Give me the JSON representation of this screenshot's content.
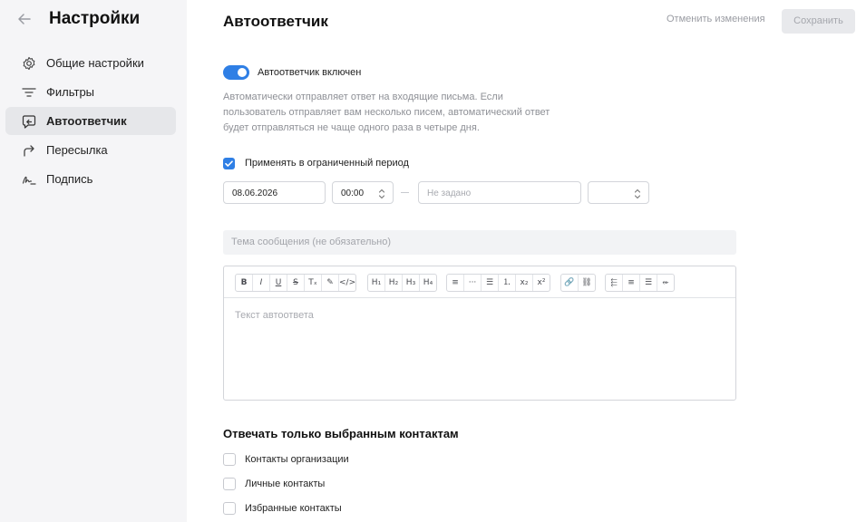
{
  "sidebar": {
    "title": "Настройки",
    "items": [
      {
        "label": "Общие настройки",
        "icon": "gear-icon"
      },
      {
        "label": "Фильтры",
        "icon": "filter-icon"
      },
      {
        "label": "Автоответчик",
        "icon": "autoreply-icon",
        "active": true
      },
      {
        "label": "Пересылка",
        "icon": "forward-icon"
      },
      {
        "label": "Подпись",
        "icon": "signature-icon"
      }
    ]
  },
  "header": {
    "title": "Автоответчик",
    "cancel_label": "Отменить изменения",
    "save_label": "Сохранить"
  },
  "autoreply": {
    "toggle_label": "Автоответчик включен",
    "toggle_on": true,
    "description": "Автоматически отправляет ответ на входящие письма. Если пользователь отправляет вам несколько писем, автоматический ответ будет отправляться не чаще одного раза в четыре дня."
  },
  "period": {
    "checkbox_label": "Применять в ограниченный период",
    "checked": true,
    "start_date": "08.06.2026",
    "start_time": "00:00",
    "end_date_placeholder": "Не задано",
    "end_time": ""
  },
  "subject_placeholder": "Тема сообщения (не обязательно)",
  "editor": {
    "placeholder": "Текст автоответа",
    "toolbar_groups": [
      [
        "B",
        "I",
        "U",
        "S",
        "Tₓ",
        "✎",
        "</>"
      ],
      [
        "H₁",
        "H₂",
        "H₃",
        "H₄"
      ],
      [
        "≡",
        "···",
        "☰",
        "⒈",
        "x₂",
        "x²"
      ],
      [
        "🔗",
        "⛓"
      ],
      [
        "⬱",
        "≡",
        "☰",
        "⬰"
      ]
    ]
  },
  "contacts": {
    "title": "Отвечать только выбранным контактам",
    "options": [
      {
        "label": "Контакты организации",
        "checked": false
      },
      {
        "label": "Личные контакты",
        "checked": false
      },
      {
        "label": "Избранные контакты",
        "checked": false
      }
    ]
  },
  "colors": {
    "accent": "#2f7fe5",
    "sidebar_bg": "#f5f5f7",
    "active_bg": "#e6e7ea"
  }
}
